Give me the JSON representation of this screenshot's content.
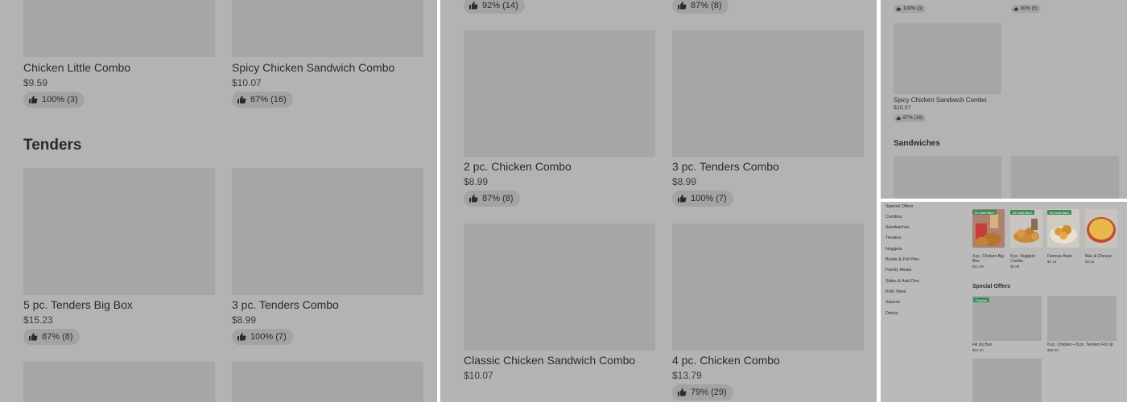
{
  "panel1": {
    "top_items": [
      {
        "name": "Chicken Little Combo",
        "price": "$9.59",
        "rating": "100% (3)"
      },
      {
        "name": "Spicy Chicken Sandwich Combo",
        "price": "$10.07",
        "rating": "87% (16)"
      }
    ],
    "section_title": "Tenders",
    "tender_items": [
      {
        "name": "5 pc. Tenders Big Box",
        "price": "$15.23",
        "rating": "87% (8)"
      },
      {
        "name": "3 pc. Tenders Combo",
        "price": "$8.99",
        "rating": "100% (7)"
      }
    ]
  },
  "panel2": {
    "top_ratings": [
      "92% (14)",
      "87% (8)"
    ],
    "items": [
      {
        "name": "2 pc. Chicken Combo",
        "price": "$8.99",
        "rating": "87% (8)"
      },
      {
        "name": "3 pc. Tenders Combo",
        "price": "$8.99",
        "rating": "100% (7)"
      },
      {
        "name": "Classic Chicken Sandwich Combo",
        "price": "$10.07",
        "rating": ""
      },
      {
        "name": "4 pc. Chicken Combo",
        "price": "$13.79",
        "rating": "79% (29)"
      }
    ]
  },
  "panel3": {
    "top_ratings": [
      "100% (3)",
      "80% (5)"
    ],
    "item": {
      "name": "Spicy Chicken Sandwich Combo",
      "price": "$10.07",
      "rating": "87% (16)"
    },
    "section_title": "Sandwiches"
  },
  "panel4": {
    "nav": [
      "Special Offers",
      "Combos",
      "Sandwiches",
      "Tenders",
      "Nuggets",
      "Bowls & Pot Pies",
      "Family Meals",
      "Sides & Add Ons",
      "Kids' Meal",
      "Sauces",
      "Drinks"
    ],
    "featured": [
      {
        "badge": "#1 most liked",
        "name": "3 pc. Chicken Big Box",
        "price": "$12.99"
      },
      {
        "badge": "#2 most liked",
        "name": "8 pc. Nuggets Combo",
        "price": "$8.99"
      },
      {
        "badge": "#3 most liked",
        "name": "Famous Bowl",
        "price": "$7.19"
      },
      {
        "badge": "",
        "name": "Mac & Cheese",
        "price": "$3.19"
      }
    ],
    "section_title": "Special Offers",
    "offers": [
      {
        "badge": "Popular",
        "name": "Fill Up Box",
        "price": "$24.00"
      },
      {
        "badge": "",
        "name": "8 pc. Chicken + 8 pc. Tenders Fill Up",
        "price": "$38.00"
      }
    ]
  },
  "colors": {
    "badge": "#3f8b5a",
    "overlay": "#b3b3b3",
    "placeholder": "#a6a6a6"
  }
}
